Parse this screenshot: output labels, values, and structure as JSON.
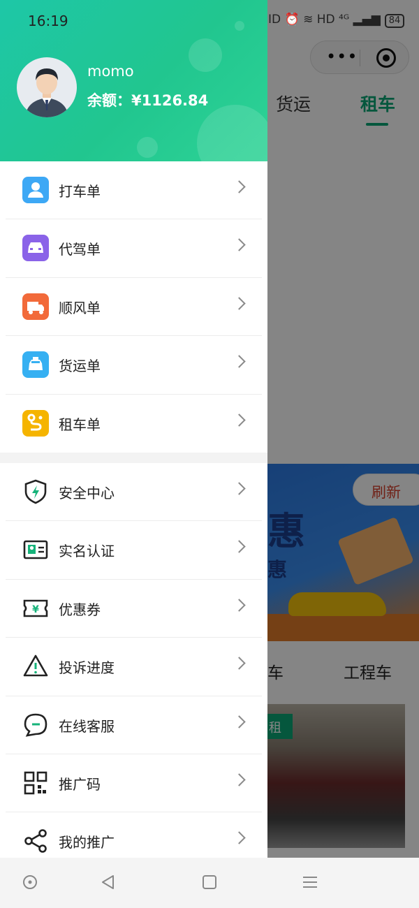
{
  "status_bar": {
    "time": "16:19",
    "indicators": "ID ⏰ ≋ HD ⁴ᴳ ▂▄▆",
    "battery": "84"
  },
  "background_page": {
    "tabs": [
      "货运",
      "租车"
    ],
    "active_tab": "租车",
    "refresh_label": "刷新",
    "banner_big": "惠",
    "banner_sub": "惠",
    "categories": [
      "车",
      "工程车"
    ],
    "photo_tag": "租"
  },
  "drawer": {
    "user": {
      "name": "momo",
      "balance_label": "余额：",
      "balance_value": "¥1126.84"
    },
    "orders": [
      {
        "label": "打车单",
        "icon": "passenger-icon",
        "color": "#3da8f5"
      },
      {
        "label": "代驾单",
        "icon": "chauffeur-car-icon",
        "color": "#8a63e8"
      },
      {
        "label": "顺风单",
        "icon": "truck-icon",
        "color": "#f26a3a"
      },
      {
        "label": "货运单",
        "icon": "taxi-icon",
        "color": "#36b0f2"
      },
      {
        "label": "租车单",
        "icon": "route-icon",
        "color": "#f5b400"
      }
    ],
    "services": [
      {
        "label": "安全中心",
        "icon": "shield-icon"
      },
      {
        "label": "实名认证",
        "icon": "id-card-icon"
      },
      {
        "label": "优惠券",
        "icon": "coupon-icon"
      },
      {
        "label": "投诉进度",
        "icon": "warning-icon"
      },
      {
        "label": "在线客服",
        "icon": "chat-icon"
      },
      {
        "label": "推广码",
        "icon": "qr-code-icon"
      },
      {
        "label": "我的推广",
        "icon": "share-icon"
      }
    ]
  },
  "nav_bar": {
    "buttons": [
      "circle-button",
      "back-button",
      "home-button",
      "menu-button"
    ]
  },
  "colors": {
    "header_green": "#21c68f",
    "accent_green": "#0aa876",
    "refresh_red": "#d6402c"
  }
}
